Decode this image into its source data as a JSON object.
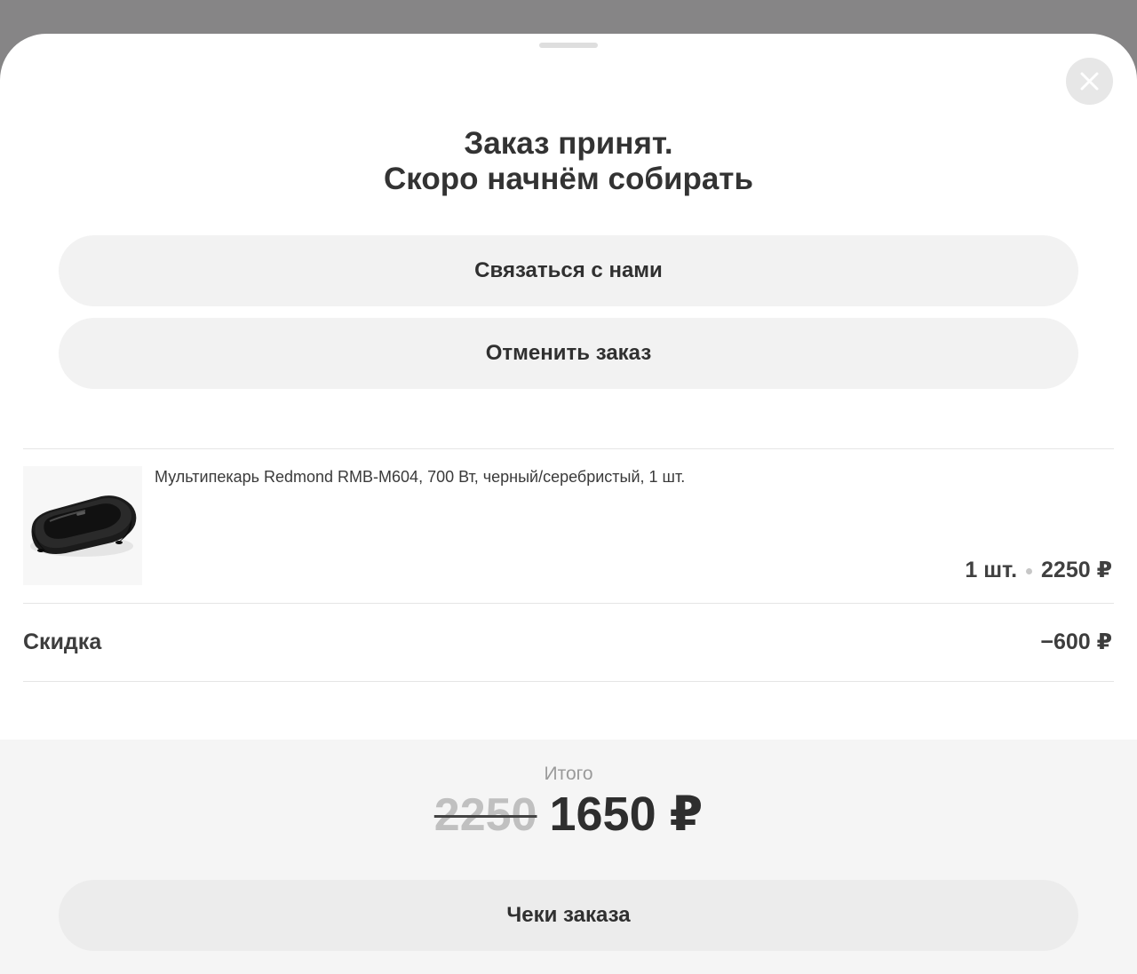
{
  "sheet": {
    "close_icon": "close-icon",
    "title_line1": "Заказ принят.",
    "title_line2": "Скоро начнём собирать"
  },
  "actions": {
    "contact_label": "Связаться с нами",
    "cancel_label": "Отменить заказ"
  },
  "order_item": {
    "image_icon": "sandwich-maker-image",
    "name": "Мультипекарь Redmond RMB-M604, 700 Вт, черный/серебристый, 1 шт.",
    "quantity": "1 шт.",
    "price": "2250 ₽"
  },
  "discount": {
    "label": "Скидка",
    "value": "−600 ₽"
  },
  "summary": {
    "total_label": "Итого",
    "old_total": "2250",
    "new_total": "1650 ₽",
    "receipts_label": "Чеки заказа"
  }
}
